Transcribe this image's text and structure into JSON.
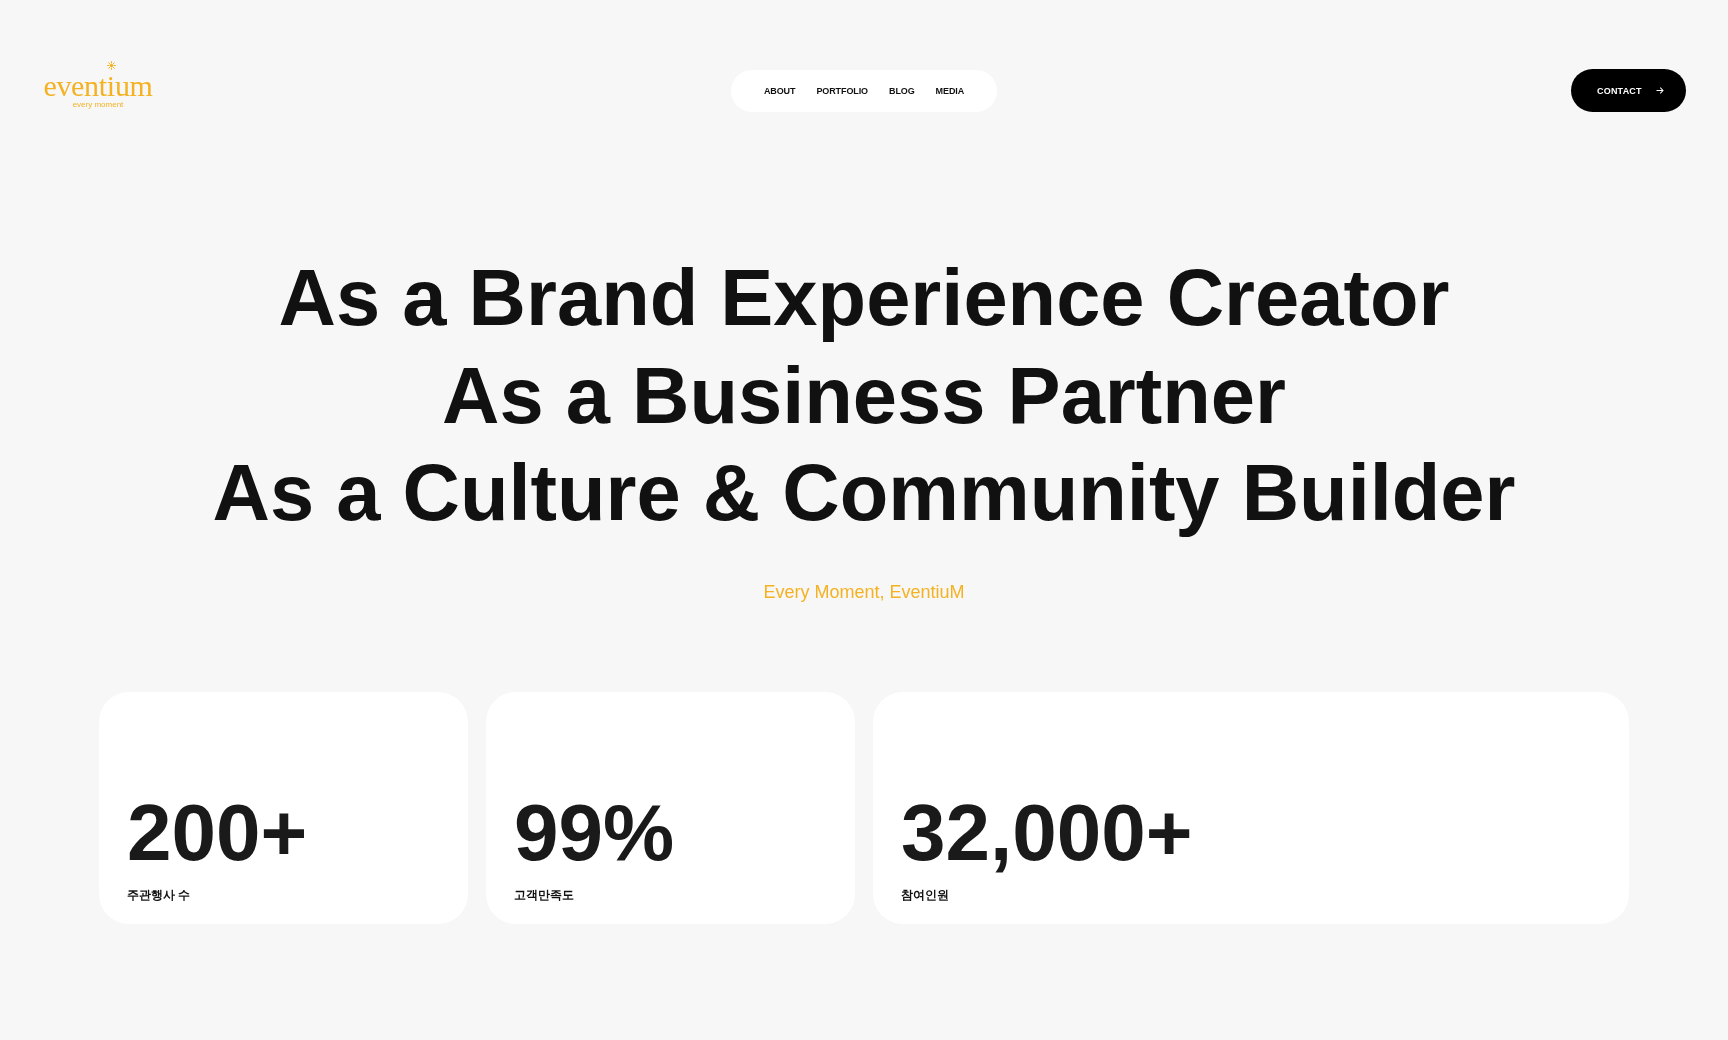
{
  "logo": {
    "wordmark": "eventium",
    "tagline": "every moment"
  },
  "nav": {
    "items": [
      "ABOUT",
      "PORTFOLIO",
      "BLOG",
      "MEDIA"
    ]
  },
  "contact_button": {
    "label": "CONTACT"
  },
  "hero": {
    "headlines": [
      "As a Brand Experience Creator",
      "As a Business Partner",
      "As a Culture & Community Builder"
    ],
    "tagline": "Every Moment, EventiuM"
  },
  "stats": [
    {
      "value": "200+",
      "label": "주관행사 수"
    },
    {
      "value": "99%",
      "label": "고객만족도"
    },
    {
      "value": "32,000+",
      "label": "참여인원"
    }
  ]
}
